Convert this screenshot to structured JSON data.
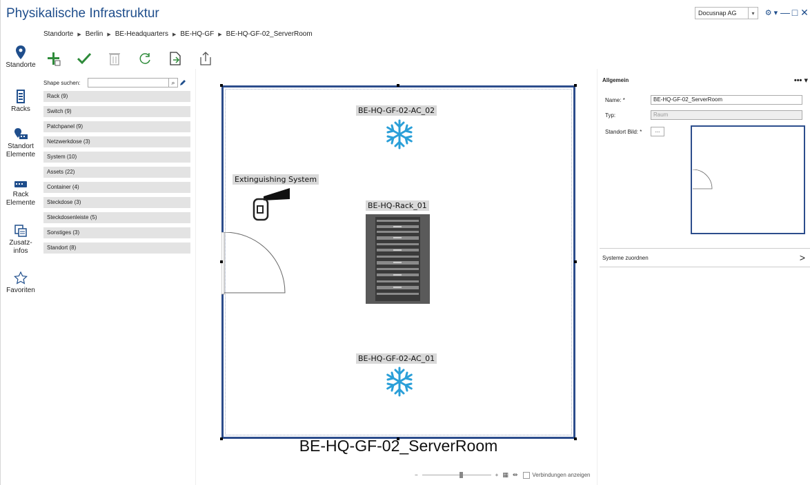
{
  "app": {
    "title": "Physikalische Infrastruktur"
  },
  "header": {
    "company": "Docusnap AG",
    "controls": {
      "settings": "⚙ ▾",
      "minimize": "—",
      "maximize": "□",
      "close": "✕"
    }
  },
  "breadcrumb": [
    "Standorte",
    "Berlin",
    "BE-Headquarters",
    "BE-HQ-GF",
    "BE-HQ-GF-02_ServerRoom"
  ],
  "nav": [
    {
      "label": "Standorte",
      "icon": "location-pin-icon"
    },
    {
      "label": "Racks",
      "icon": "rack-icon"
    },
    {
      "label": "Standort Elemente",
      "icon": "location-elements-icon"
    },
    {
      "label": "Rack Elemente",
      "icon": "rack-elements-icon"
    },
    {
      "label": "Zusatz-infos",
      "icon": "additional-info-icon"
    },
    {
      "label": "Favoriten",
      "icon": "star-icon"
    }
  ],
  "toolbar": [
    "add-icon",
    "check-icon",
    "delete-icon",
    "refresh-icon",
    "export-icon",
    "share-icon"
  ],
  "shapes": {
    "search_label": "Shape suchen:",
    "categories": [
      "Rack (9)",
      "Switch (9)",
      "Patchpanel (9)",
      "Netzwerkdose (3)",
      "System (10)",
      "Assets (22)",
      "Container (4)",
      "Steckdose (3)",
      "Steckdosenleiste (5)",
      "Sonstiges (3)",
      "Standort (8)"
    ]
  },
  "canvas": {
    "room_name": "BE-HQ-GF-02_ServerRoom",
    "ac_top": "BE-HQ-GF-02-AC_02",
    "ac_bottom": "BE-HQ-GF-02-AC_01",
    "extinguisher": "Extinguishing System",
    "rack": "BE-HQ-Rack_01",
    "zoom_minus": "−",
    "zoom_plus": "+",
    "connections_label": "Verbindungen anzeigen"
  },
  "properties": {
    "section": "Allgemein",
    "menu": "••• ▾",
    "name_label": "Name: *",
    "name_value": "BE-HQ-GF-02_ServerRoom",
    "type_label": "Typ:",
    "type_value": "Raum",
    "image_label": "Standort Bild: *",
    "image_button": "...",
    "assign_label": "Systeme zuordnen",
    "assign_chevron": ">"
  },
  "colors": {
    "accent": "#1f4e8c",
    "room_border": "#2c4d8c",
    "ac_blue": "#2a9fd8",
    "add_green": "#2e8b3a"
  }
}
